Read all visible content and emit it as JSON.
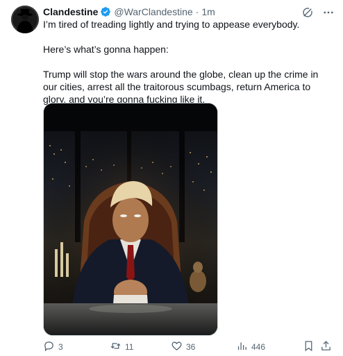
{
  "tweet": {
    "author_name": "Clandestine",
    "handle": "@WarClandestine",
    "separator": "·",
    "time": "1m",
    "paragraphs": [
      "I’m tired of treading lightly and trying to appease everybody.",
      "Here’s what’s gonna happen:",
      "Trump will stop the wars around the globe, clean up the crime in our cities, arrest all the traitorous scumbags, return America to glory, and you’re gonna fucking like it."
    ],
    "media_icon_name": "ai-portrait-image"
  },
  "actions": {
    "replies": "3",
    "reposts": "11",
    "likes": "36",
    "views": "446"
  },
  "colors": {
    "text": "#0f1419",
    "secondary": "#536471",
    "verified": "#1d9bf0",
    "border": "#cfd9de"
  },
  "icons": {
    "grok": "grok-icon",
    "more": "more-icon",
    "reply": "reply-icon",
    "repost": "repost-icon",
    "like": "heart-icon",
    "views": "views-icon",
    "bookmark": "bookmark-icon",
    "share": "share-icon"
  }
}
